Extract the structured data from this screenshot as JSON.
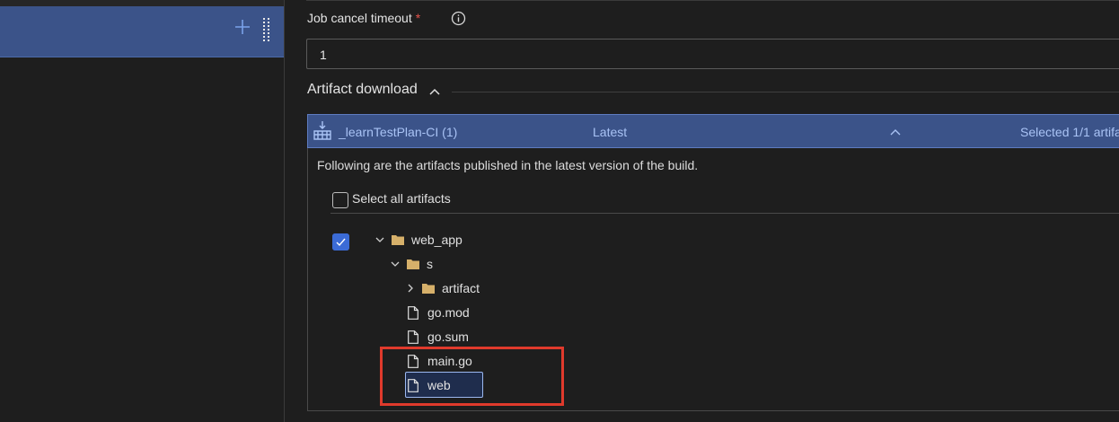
{
  "left_panel": {
    "add_icon": "plus-icon",
    "drag_icon": "drag-handle-icon"
  },
  "job_settings": {
    "timeout_label": "Job cancel timeout",
    "required_marker": "*",
    "timeout_value": "1"
  },
  "artifact_download": {
    "section_title": "Artifact download",
    "header": {
      "name": "_learnTestPlan-CI (1)",
      "version": "Latest",
      "selection": "Selected 1/1 artifa"
    },
    "description": "Following are the artifacts published in the latest version of the build.",
    "select_all_label": "Select all artifacts",
    "select_all_checked": false,
    "tree": {
      "root": {
        "label": "web_app",
        "checked": true,
        "expanded": true
      },
      "folder_s": {
        "label": "s",
        "expanded": true
      },
      "folder_artifact": {
        "label": "artifact",
        "expanded": false
      },
      "file_gomod": {
        "label": "go.mod"
      },
      "file_gosum": {
        "label": "go.sum"
      },
      "file_maingo": {
        "label": "main.go"
      },
      "file_web": {
        "label": "web",
        "focused": true
      }
    }
  },
  "colors": {
    "accent": "#3b5389",
    "checkbox": "#3b6bd6",
    "header_text": "#a9c3f5",
    "required": "#e5534b",
    "highlight": "#e03a2c",
    "folder": "#d6b06a"
  }
}
